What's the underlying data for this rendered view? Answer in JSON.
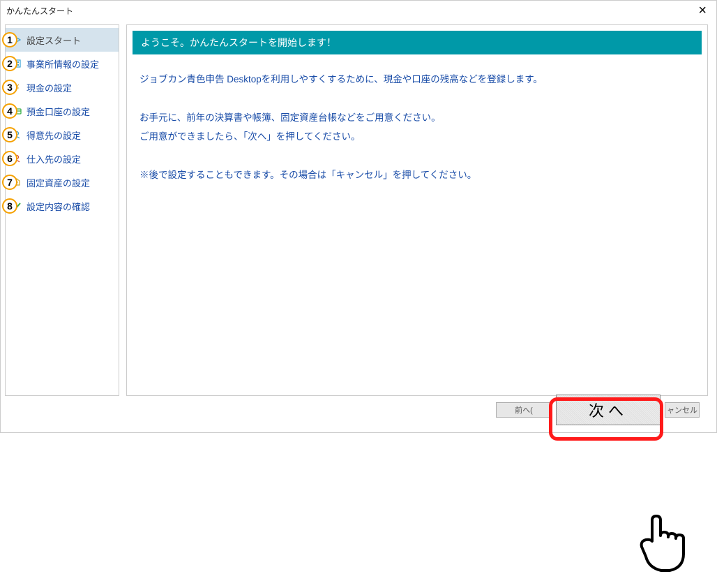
{
  "window": {
    "title": "かんたんスタート",
    "close_symbol": "×"
  },
  "sidebar": {
    "items": [
      {
        "label": "設定スタート",
        "active": true,
        "icon": "start"
      },
      {
        "label": "事業所情報の設定",
        "active": false,
        "icon": "building"
      },
      {
        "label": "現金の設定",
        "active": false,
        "icon": "yen"
      },
      {
        "label": "預金口座の設定",
        "active": false,
        "icon": "account"
      },
      {
        "label": "得意先の設定",
        "active": false,
        "icon": "customer"
      },
      {
        "label": "仕入先の設定",
        "active": false,
        "icon": "supplier"
      },
      {
        "label": "固定資産の設定",
        "active": false,
        "icon": "asset"
      },
      {
        "label": "設定内容の確認",
        "active": false,
        "icon": "check"
      }
    ]
  },
  "content": {
    "header": "ようこそ。かんたんスタートを開始します！",
    "para1": "ジョブカン青色申告 Desktopを利用しやすくするために、現金や口座の残高などを登録します。",
    "para2a": "お手元に、前年の決算書や帳簿、固定資産台帳などをご用意ください。",
    "para2b": "ご用意ができましたら、「次へ」を押してください。",
    "para3": "※後で設定することもできます。その場合は「キャンセル」を押してください。"
  },
  "buttons": {
    "back": "前へ(",
    "next": "次へ",
    "cancel": "ャンセル"
  },
  "annotations": {
    "steps": [
      "1",
      "2",
      "3",
      "4",
      "5",
      "6",
      "7",
      "8"
    ]
  }
}
